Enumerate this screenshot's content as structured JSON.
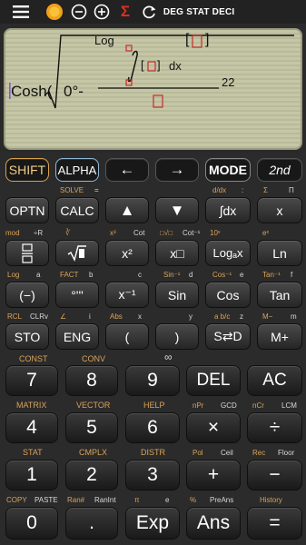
{
  "topbar": {
    "indicators": [
      "DEG",
      "STAT",
      "DECI"
    ],
    "sigma": "Σ"
  },
  "display": {
    "func": "Cosh(",
    "degree_value": "0°-",
    "log_label": "Log",
    "dx_label": "dx",
    "exponent": "22",
    "bracket_left": "[",
    "bracket_right": "]"
  },
  "keys": {
    "row1": [
      "SHIFT",
      "ALPHA",
      "←",
      "→",
      "MODE",
      "2nd"
    ],
    "row2": [
      "OPTN",
      "CALC",
      "▲",
      "▼",
      "∫dx",
      "x"
    ],
    "row3": [
      "x²",
      "x□",
      "Logₐx",
      "Ln"
    ],
    "row4": [
      "(−)",
      "°'''",
      "x⁻¹",
      "Sin",
      "Cos",
      "Tan"
    ],
    "row5": [
      "STO",
      "ENG",
      "(",
      ")",
      "S⇄D",
      "M+"
    ],
    "row6": [
      "7",
      "8",
      "9",
      "DEL",
      "AC"
    ],
    "row7": [
      "4",
      "5",
      "6",
      "×",
      "÷"
    ],
    "row8": [
      "1",
      "2",
      "3",
      "+",
      "−"
    ],
    "row9": [
      "0",
      ".",
      "Exp",
      "Ans",
      "="
    ]
  },
  "labels": {
    "solve": "SOLVE",
    "solve_eq": "=",
    "ddx": "d/dx",
    "colon": ":",
    "sum": "Σ",
    "prod": "Π",
    "mod": "mod",
    "divr": "÷R",
    "cbrt": "∛",
    "x3": "x³",
    "cot": "Cot",
    "nthroot": "□√□",
    "cot_inv": "Cot⁻¹",
    "tenx": "10ˣ",
    "ex": "eˣ",
    "log": "Log",
    "a": "a",
    "fact": "FACT",
    "b": "b",
    "c": "c",
    "sin_inv": "Sin⁻¹",
    "d": "d",
    "cos_inv": "Cos⁻¹",
    "e": "e",
    "tan_inv": "Tan⁻¹",
    "f": "f",
    "rcl": "RCL",
    "clrv": "CLRv",
    "angle": "∠",
    "i": "i",
    "abs": "Abs",
    "x": "x",
    "y": "y",
    "abc": "a b/c",
    "z": "z",
    "mminus": "M−",
    "m": "m",
    "const": "CONST",
    "conv": "CONV",
    "inf": "∞",
    "matrix": "MATRIX",
    "vector": "VECTOR",
    "help": "HELP",
    "npr": "nPr",
    "gcd": "GCD",
    "ncr": "nCr",
    "lcm": "LCM",
    "stat": "STAT",
    "cmplx": "CMPLX",
    "distr": "DISTR",
    "pol": "Pol",
    "ceil": "Ceil",
    "rec": "Rec",
    "floor": "Floor",
    "copy": "COPY",
    "paste": "PASTE",
    "ranhash": "Ran#",
    "ranint": "RanInt",
    "pi": "π",
    "e2": "e",
    "pct": "%",
    "preans": "PreAns",
    "history": "History"
  },
  "colors": {
    "accent_orange": "#d9a35a",
    "screen_bg": "#c4c6a6",
    "key_bg": "#333333",
    "sigma_red": "#e0301e"
  }
}
